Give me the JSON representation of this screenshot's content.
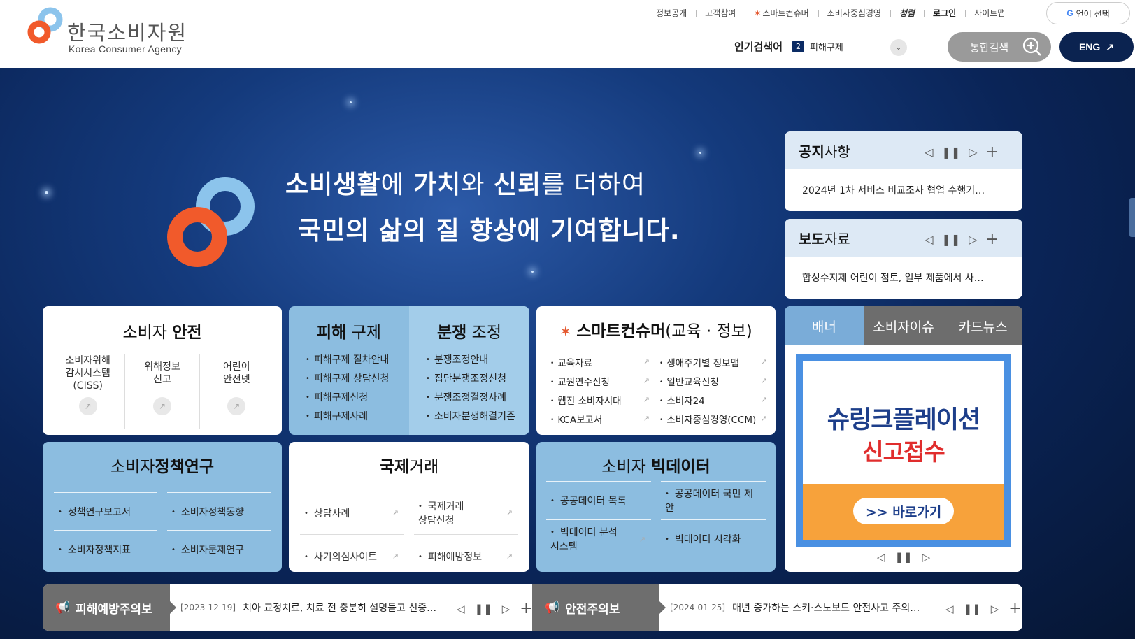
{
  "header": {
    "logo_ko": "한국소비자원",
    "logo_en": "Korea Consumer Agency",
    "util_links": [
      {
        "label": "정보공개"
      },
      {
        "label": "고객참여"
      },
      {
        "label": "스마트컨슈머"
      },
      {
        "label": "소비자중심경영"
      },
      {
        "label": "청렴"
      },
      {
        "label": "로그인"
      },
      {
        "label": "사이트맵"
      }
    ],
    "language_button": "언어 선택",
    "popular_label": "인기검색어",
    "popular_rank": "2",
    "popular_term": "피해구제",
    "search_button": "통합검색",
    "eng_button": "ENG"
  },
  "hero": {
    "line1_parts": [
      "소비생활",
      "에 ",
      "가치",
      "와 ",
      "신뢰",
      "를 더하여"
    ],
    "line2": "국민의 삶의 질 향상에 기여합니다."
  },
  "cards": {
    "safety": {
      "title_a": "소비자 ",
      "title_b": "안전",
      "items": [
        {
          "label": "소비자위해\n감시시스템\n(CISS)"
        },
        {
          "label": "위해정보\n신고"
        },
        {
          "label": "어린이\n안전넷"
        }
      ]
    },
    "relief": {
      "title_a_bold": "피해",
      "title_a_rest": " 구제",
      "items_a": [
        "피해구제 절차안내",
        "피해구제 상담신청",
        "피해구제신청",
        "피해구제사례"
      ],
      "title_b_bold": "분쟁",
      "title_b_rest": " 조정",
      "items_b": [
        "분쟁조정안내",
        "집단분쟁조정신청",
        "분쟁조정결정사례",
        "소비자분쟁해결기준"
      ]
    },
    "smart": {
      "title_bold": "스마트컨슈머",
      "title_rest": "(교육 · 정보)",
      "items": [
        "교육자료",
        "생애주기별 정보맵",
        "교원연수신청",
        "일반교육신청",
        "웹진 소비자시대",
        "소비자24",
        "KCA보고서",
        "소비자중심경영(CCM)"
      ]
    },
    "policy": {
      "title_a": "소비자",
      "title_b": "정책연구",
      "items": [
        "정책연구보고서",
        "소비자정책동향",
        "소비자정책지표",
        "소비자문제연구"
      ]
    },
    "intl": {
      "title_a": "국제",
      "title_b": "거래",
      "items": [
        "상담사례",
        "국제거래\n상담신청",
        "사기의심사이트",
        "피해예방정보"
      ]
    },
    "bigdata": {
      "title_a": "소비자 ",
      "title_b": "빅데이터",
      "items": [
        "공공데이터 목록",
        "공공데이터 국민 제안",
        "빅데이터 분석\n시스템",
        "빅데이터 시각화"
      ]
    }
  },
  "notice": {
    "title_bold": "공지",
    "title_rest": "사항",
    "item": "2024년 1차 서비스 비교조사 협업 수행기…"
  },
  "press": {
    "title_bold": "보도",
    "title_rest": "자료",
    "item": "합성수지제 어린이 점토, 일부 제품에서 사…"
  },
  "banner": {
    "tabs": [
      "배너",
      "소비자이슈",
      "카드뉴스"
    ],
    "promo_line1": "슈링크플레이션",
    "promo_line2": "신고접수",
    "promo_button": ">> 바로가기"
  },
  "alerts": {
    "damage_label": "피해예방주의보",
    "damage_date": "[2023-12-19]",
    "damage_text": "치아 교정치료, 치료 전 충분히 설명듣고 신중…",
    "safety_label": "안전주의보",
    "safety_date": "[2024-01-25]",
    "safety_text": "매년 증가하는 스키·스노보드 안전사고 주의…"
  },
  "colors": {
    "brand_orange": "#f15a2b",
    "brand_blue": "#8cc4ec",
    "navy": "#0b2350",
    "card_blue": "#8cbde0"
  }
}
